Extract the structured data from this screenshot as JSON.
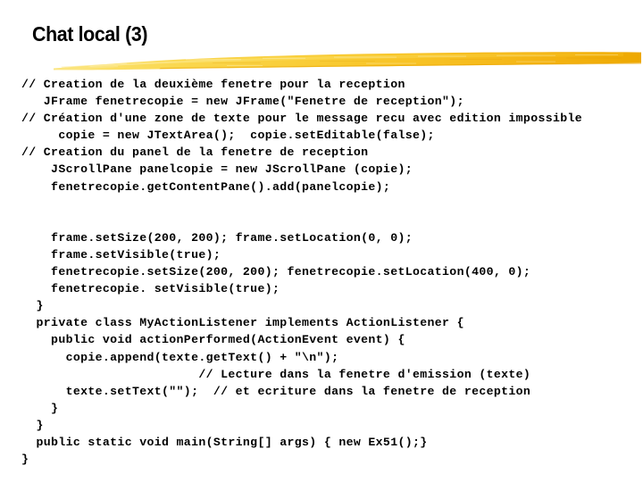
{
  "slide": {
    "title": "Chat local (3)",
    "background_color": "#ffffff",
    "text_color": "#000000",
    "accent_colors": {
      "brush_light": "#FBE26A",
      "brush_mid": "#F9CF3C",
      "brush_gold": "#F5B91A",
      "brush_dark": "#EDA800"
    },
    "decoration_name": "yellow-brush-stroke-underline"
  },
  "code": {
    "language": "java",
    "lines": [
      "// Creation de la deuxième fenetre pour la reception",
      "   JFrame fenetrecopie = new JFrame(\"Fenetre de reception\");",
      "// Création d'une zone de texte pour le message recu avec edition impossible",
      "     copie = new JTextArea();  copie.setEditable(false);",
      "// Creation du panel de la fenetre de reception",
      "    JScrollPane panelcopie = new JScrollPane (copie);",
      "    fenetrecopie.getContentPane().add(panelcopie);",
      "",
      "",
      "    frame.setSize(200, 200); frame.setLocation(0, 0);",
      "    frame.setVisible(true);",
      "    fenetrecopie.setSize(200, 200); fenetrecopie.setLocation(400, 0);",
      "    fenetrecopie. setVisible(true);",
      "  }",
      "  private class MyActionListener implements ActionListener {",
      "    public void actionPerformed(ActionEvent event) {",
      "      copie.append(texte.getText() + \"\\n\");",
      "                        // Lecture dans la fenetre d'emission (texte)",
      "      texte.setText(\"\");  // et ecriture dans la fenetre de reception",
      "    }",
      "  }",
      "  public static void main(String[] args) { new Ex51();}",
      "}"
    ]
  }
}
